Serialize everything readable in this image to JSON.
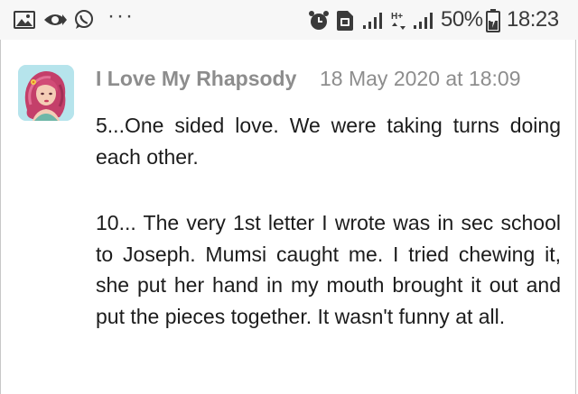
{
  "status_bar": {
    "left_icons": [
      "gallery-icon",
      "cast-icon",
      "whatsapp-icon"
    ],
    "more_indicator": "···",
    "battery_percent": "50%",
    "time": "18:23",
    "network_label": "H+"
  },
  "comment": {
    "author": "I Love My Rhapsody",
    "timestamp": "18 May 2020 at 18:09",
    "paragraphs": [
      "5...One sided love. We were taking turns doing each other.",
      "10... The very 1st letter I wrote was in sec school to Joseph. Mumsi caught me. I tried chewing it, she put her hand in my mouth brought it out and put the pieces together. It wasn't funny at all."
    ]
  },
  "colors": {
    "status_bar_bg": "#f7f7f7",
    "meta_text": "#8d8d8d",
    "body_text": "#1c1c1c"
  }
}
